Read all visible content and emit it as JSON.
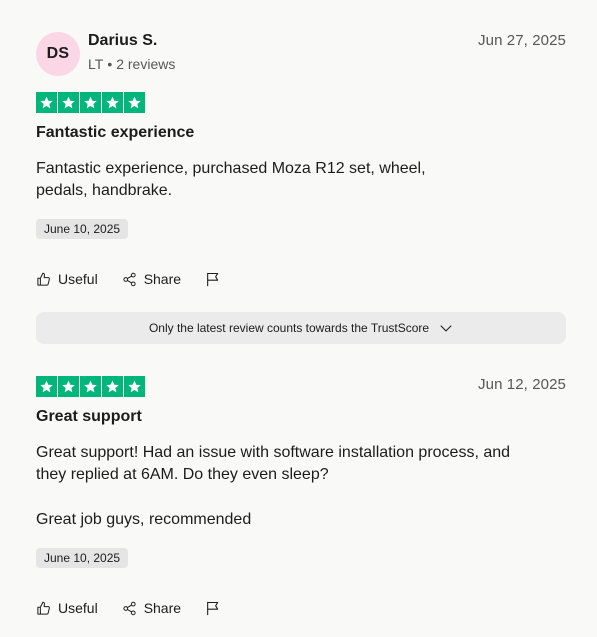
{
  "reviews": [
    {
      "avatar_initials": "DS",
      "reviewer_name": "Darius S.",
      "country": "LT",
      "review_count": "2 reviews",
      "date": "Jun 27, 2025",
      "rating": 5,
      "title": "Fantastic experience",
      "body": [
        "Fantastic experience, purchased Moza R12 set, wheel,",
        "pedals, handbrake."
      ],
      "experience_date": "June 10, 2025",
      "useful_label": "Useful",
      "share_label": "Share"
    },
    {
      "date": "Jun 12, 2025",
      "rating": 5,
      "title": "Great support",
      "body": [
        "Great support! Had an issue with software installation process, and",
        "they replied at 6AM. Do they even sleep?"
      ],
      "body_extra": "Great job guys, recommended",
      "experience_date": "June 10, 2025",
      "useful_label": "Useful",
      "share_label": "Share"
    }
  ],
  "notice": {
    "text": "Only the latest review counts towards the TrustScore"
  },
  "colors": {
    "star_green": "#00b67a",
    "avatar_pink": "#fbd7e6",
    "background": "#f9f9f8"
  },
  "icons": {
    "useful": "thumbs-up-icon",
    "share": "share-icon",
    "report": "flag-icon",
    "expand": "chevron-down-icon",
    "star": "star-icon"
  }
}
